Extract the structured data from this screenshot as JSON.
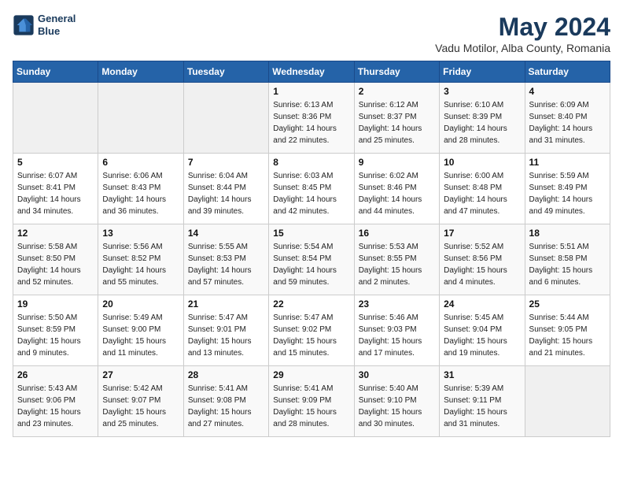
{
  "logo": {
    "line1": "General",
    "line2": "Blue"
  },
  "title": "May 2024",
  "location": "Vadu Motilor, Alba County, Romania",
  "days_header": [
    "Sunday",
    "Monday",
    "Tuesday",
    "Wednesday",
    "Thursday",
    "Friday",
    "Saturday"
  ],
  "weeks": [
    [
      {
        "num": "",
        "detail": ""
      },
      {
        "num": "",
        "detail": ""
      },
      {
        "num": "",
        "detail": ""
      },
      {
        "num": "1",
        "detail": "Sunrise: 6:13 AM\nSunset: 8:36 PM\nDaylight: 14 hours\nand 22 minutes."
      },
      {
        "num": "2",
        "detail": "Sunrise: 6:12 AM\nSunset: 8:37 PM\nDaylight: 14 hours\nand 25 minutes."
      },
      {
        "num": "3",
        "detail": "Sunrise: 6:10 AM\nSunset: 8:39 PM\nDaylight: 14 hours\nand 28 minutes."
      },
      {
        "num": "4",
        "detail": "Sunrise: 6:09 AM\nSunset: 8:40 PM\nDaylight: 14 hours\nand 31 minutes."
      }
    ],
    [
      {
        "num": "5",
        "detail": "Sunrise: 6:07 AM\nSunset: 8:41 PM\nDaylight: 14 hours\nand 34 minutes."
      },
      {
        "num": "6",
        "detail": "Sunrise: 6:06 AM\nSunset: 8:43 PM\nDaylight: 14 hours\nand 36 minutes."
      },
      {
        "num": "7",
        "detail": "Sunrise: 6:04 AM\nSunset: 8:44 PM\nDaylight: 14 hours\nand 39 minutes."
      },
      {
        "num": "8",
        "detail": "Sunrise: 6:03 AM\nSunset: 8:45 PM\nDaylight: 14 hours\nand 42 minutes."
      },
      {
        "num": "9",
        "detail": "Sunrise: 6:02 AM\nSunset: 8:46 PM\nDaylight: 14 hours\nand 44 minutes."
      },
      {
        "num": "10",
        "detail": "Sunrise: 6:00 AM\nSunset: 8:48 PM\nDaylight: 14 hours\nand 47 minutes."
      },
      {
        "num": "11",
        "detail": "Sunrise: 5:59 AM\nSunset: 8:49 PM\nDaylight: 14 hours\nand 49 minutes."
      }
    ],
    [
      {
        "num": "12",
        "detail": "Sunrise: 5:58 AM\nSunset: 8:50 PM\nDaylight: 14 hours\nand 52 minutes."
      },
      {
        "num": "13",
        "detail": "Sunrise: 5:56 AM\nSunset: 8:52 PM\nDaylight: 14 hours\nand 55 minutes."
      },
      {
        "num": "14",
        "detail": "Sunrise: 5:55 AM\nSunset: 8:53 PM\nDaylight: 14 hours\nand 57 minutes."
      },
      {
        "num": "15",
        "detail": "Sunrise: 5:54 AM\nSunset: 8:54 PM\nDaylight: 14 hours\nand 59 minutes."
      },
      {
        "num": "16",
        "detail": "Sunrise: 5:53 AM\nSunset: 8:55 PM\nDaylight: 15 hours\nand 2 minutes."
      },
      {
        "num": "17",
        "detail": "Sunrise: 5:52 AM\nSunset: 8:56 PM\nDaylight: 15 hours\nand 4 minutes."
      },
      {
        "num": "18",
        "detail": "Sunrise: 5:51 AM\nSunset: 8:58 PM\nDaylight: 15 hours\nand 6 minutes."
      }
    ],
    [
      {
        "num": "19",
        "detail": "Sunrise: 5:50 AM\nSunset: 8:59 PM\nDaylight: 15 hours\nand 9 minutes."
      },
      {
        "num": "20",
        "detail": "Sunrise: 5:49 AM\nSunset: 9:00 PM\nDaylight: 15 hours\nand 11 minutes."
      },
      {
        "num": "21",
        "detail": "Sunrise: 5:47 AM\nSunset: 9:01 PM\nDaylight: 15 hours\nand 13 minutes."
      },
      {
        "num": "22",
        "detail": "Sunrise: 5:47 AM\nSunset: 9:02 PM\nDaylight: 15 hours\nand 15 minutes."
      },
      {
        "num": "23",
        "detail": "Sunrise: 5:46 AM\nSunset: 9:03 PM\nDaylight: 15 hours\nand 17 minutes."
      },
      {
        "num": "24",
        "detail": "Sunrise: 5:45 AM\nSunset: 9:04 PM\nDaylight: 15 hours\nand 19 minutes."
      },
      {
        "num": "25",
        "detail": "Sunrise: 5:44 AM\nSunset: 9:05 PM\nDaylight: 15 hours\nand 21 minutes."
      }
    ],
    [
      {
        "num": "26",
        "detail": "Sunrise: 5:43 AM\nSunset: 9:06 PM\nDaylight: 15 hours\nand 23 minutes."
      },
      {
        "num": "27",
        "detail": "Sunrise: 5:42 AM\nSunset: 9:07 PM\nDaylight: 15 hours\nand 25 minutes."
      },
      {
        "num": "28",
        "detail": "Sunrise: 5:41 AM\nSunset: 9:08 PM\nDaylight: 15 hours\nand 27 minutes."
      },
      {
        "num": "29",
        "detail": "Sunrise: 5:41 AM\nSunset: 9:09 PM\nDaylight: 15 hours\nand 28 minutes."
      },
      {
        "num": "30",
        "detail": "Sunrise: 5:40 AM\nSunset: 9:10 PM\nDaylight: 15 hours\nand 30 minutes."
      },
      {
        "num": "31",
        "detail": "Sunrise: 5:39 AM\nSunset: 9:11 PM\nDaylight: 15 hours\nand 31 minutes."
      },
      {
        "num": "",
        "detail": ""
      }
    ]
  ]
}
